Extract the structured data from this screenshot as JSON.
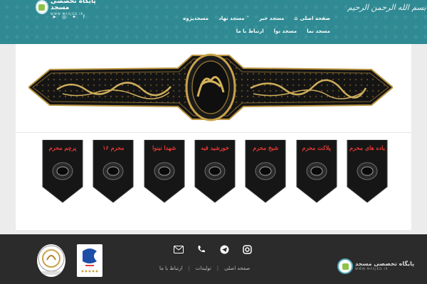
{
  "header": {
    "logo_title": "پایگاه تخصصی مسجد",
    "logo_sub": "WWW.MASJED.IR",
    "calligraphy": "بسم الله الرحمن الرحیم",
    "nav": [
      {
        "label": "صفحه اصلی",
        "icon": "home-icon"
      },
      {
        "label": "مسجد خبر"
      },
      {
        "label": "مسجد نهاد",
        "dropdown": true
      },
      {
        "label": "مسجدپژوه"
      },
      {
        "label": "مسجد نما"
      },
      {
        "label": "مسجد نوا"
      },
      {
        "label": "ارتباط با ما"
      }
    ],
    "socials": [
      "telegram-icon",
      "instagram-icon",
      "twitter-icon",
      "facebook-icon"
    ]
  },
  "flags": [
    {
      "label": "یاده های محرم"
    },
    {
      "label": "پلاکت محرم"
    },
    {
      "label": "شیخ محرم"
    },
    {
      "label": "خورشید قیه"
    },
    {
      "label": "شهدا نینوا"
    },
    {
      "label": "محرم ۱۶"
    },
    {
      "label": "پرچم محرم"
    }
  ],
  "footer": {
    "links": [
      "صفحه اصلی",
      "تولیدات",
      "ارتباط با ما"
    ],
    "icons": [
      "instagram-icon",
      "telegram-icon",
      "phone-icon",
      "email-icon"
    ],
    "logo_title": "پایگاه تخصصی مسجد",
    "logo_sub": "WWW.MASJED.IR"
  },
  "colors": {
    "header": "#2f8a93",
    "footer": "#2b2b2b",
    "gold": "#c9a24a",
    "flag_text": "#e53935"
  }
}
